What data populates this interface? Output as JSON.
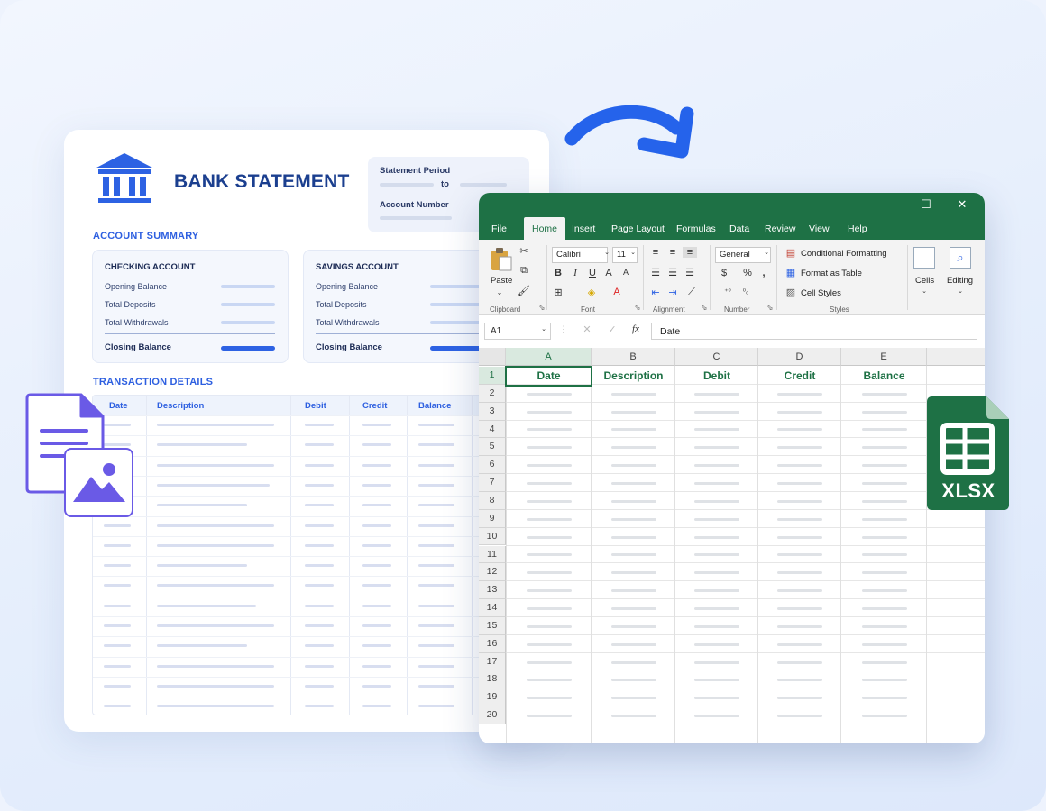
{
  "statement": {
    "title": "BANK STATEMENT",
    "period_label": "Statement Period",
    "period_to": "to",
    "account_number_label": "Account Number",
    "account_summary_title": "ACCOUNT SUMMARY",
    "checking": {
      "title": "CHECKING ACCOUNT",
      "rows": [
        "Opening Balance",
        "Total Deposits",
        "Total Withdrawals"
      ],
      "closing": "Closing Balance"
    },
    "savings": {
      "title": "SAVINGS ACCOUNT",
      "rows": [
        "Opening Balance",
        "Total Deposits",
        "Total Withdrawals"
      ],
      "closing": "Closing Balance"
    },
    "transactions_title": "TRANSACTION DETAILS",
    "transaction_headers": [
      "Date",
      "Description",
      "Debit",
      "Credit",
      "Balance"
    ]
  },
  "excel": {
    "window_controls": [
      "—",
      "☐",
      "✕"
    ],
    "tabs": [
      "File",
      "Home",
      "Insert",
      "Page Layout",
      "Formulas",
      "Data",
      "Review",
      "View",
      "Help"
    ],
    "active_tab": "Home",
    "ribbon": {
      "paste": "Paste",
      "font_name": "Calibri",
      "font_size": "11",
      "number_format": "General",
      "conditional_formatting": "Conditional Formatting",
      "format_as_table": "Format as Table",
      "cell_styles": "Cell Styles",
      "cells": "Cells",
      "editing": "Editing",
      "groups": [
        "Clipboard",
        "Font",
        "Alignment",
        "Number",
        "Styles"
      ]
    },
    "name_box": "A1",
    "formula_value": "Date",
    "columns": [
      "A",
      "B",
      "C",
      "D",
      "E"
    ],
    "header_row": [
      "Date",
      "Description",
      "Debit",
      "Credit",
      "Balance"
    ],
    "row_numbers": [
      "1",
      "2",
      "3",
      "4",
      "5",
      "6",
      "7",
      "8",
      "9",
      "10",
      "11",
      "12",
      "13",
      "14",
      "15",
      "16",
      "17",
      "18",
      "19",
      "20"
    ]
  },
  "badge": {
    "label": "XLSX"
  },
  "colors": {
    "excel_green": "#1e7145",
    "statement_blue": "#2d5fe0",
    "title_navy": "#1b3f8f",
    "arrow_blue": "#2563eb"
  },
  "icons": [
    "bank-icon",
    "document-icon",
    "image-icon",
    "arrow-icon",
    "spreadsheet-icon"
  ]
}
